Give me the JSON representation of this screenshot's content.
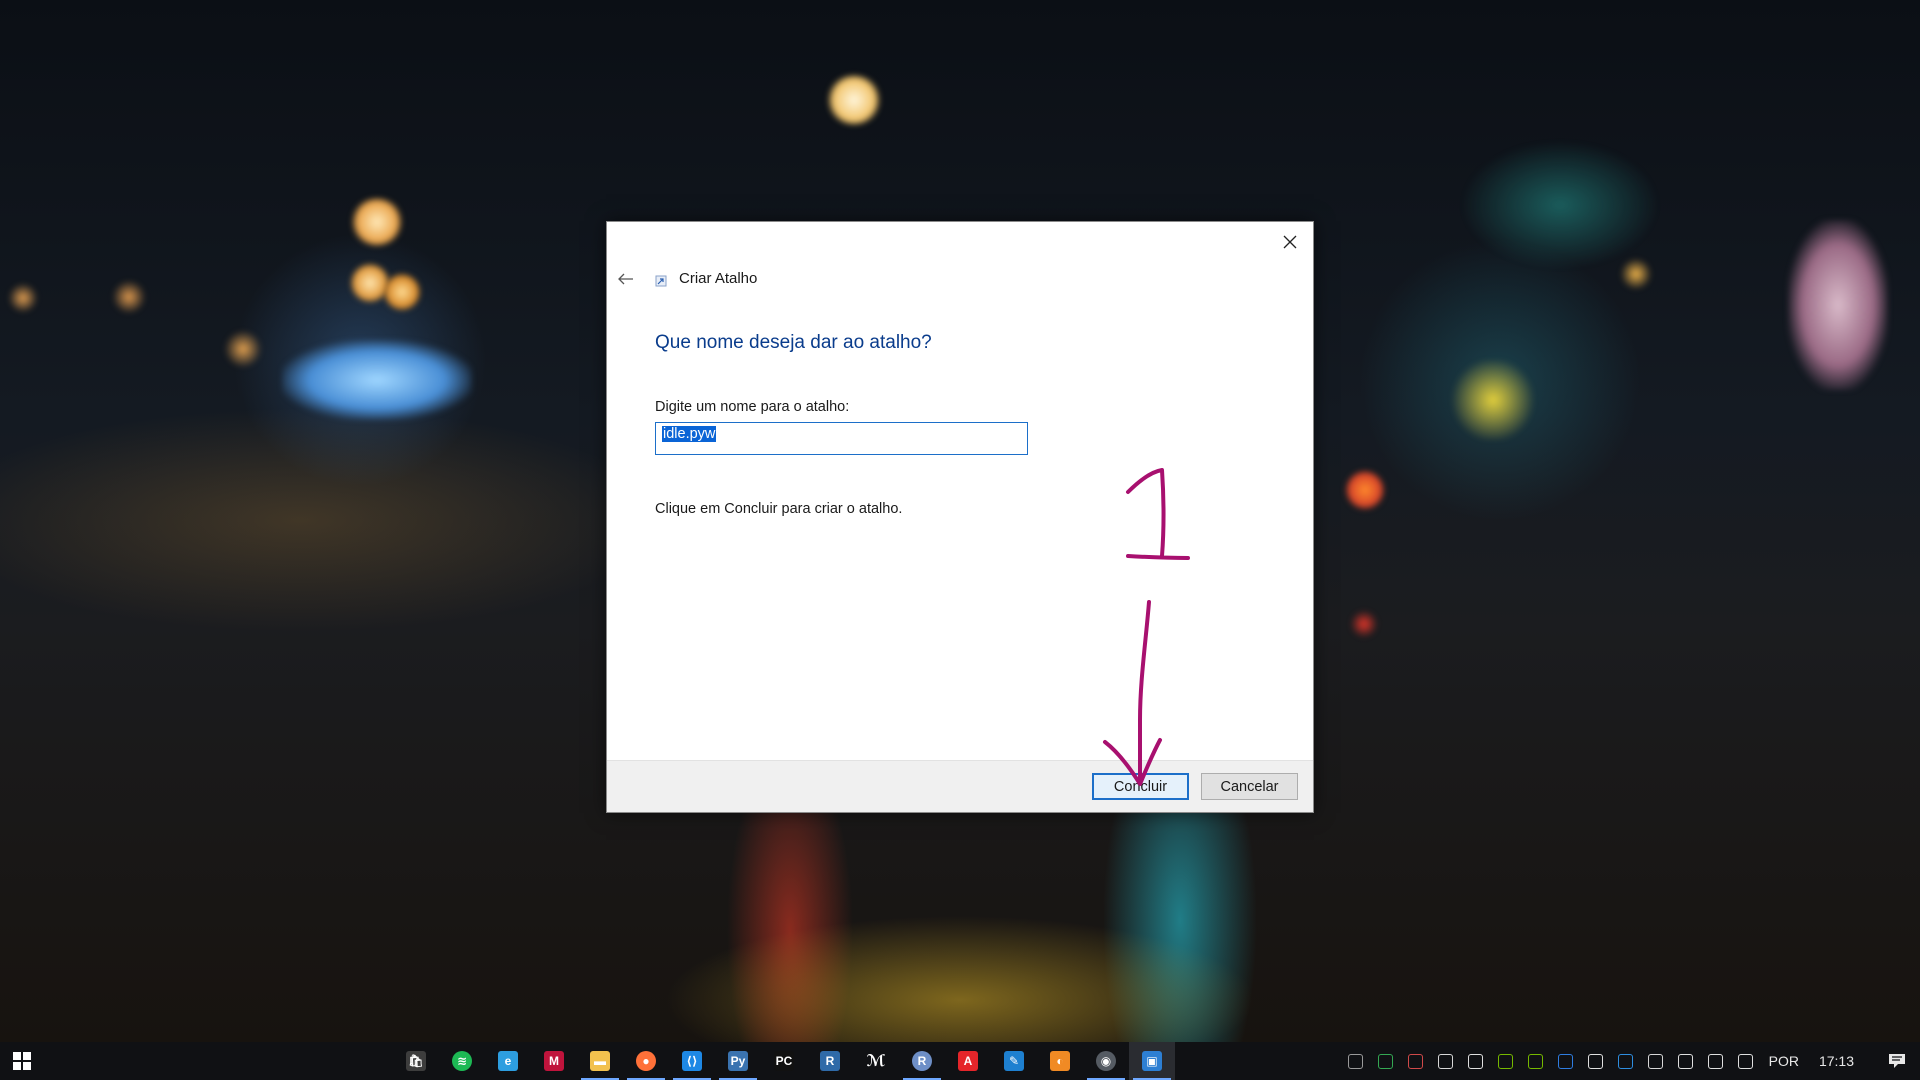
{
  "dialog": {
    "title": "Criar Atalho",
    "main_instruction": "Que nome deseja dar ao atalho?",
    "field_label": "Digite um nome para o atalho:",
    "field_value": "idle.pyw",
    "hint": "Clique em Concluir para criar o atalho.",
    "finish_label": "Concluir",
    "cancel_label": "Cancelar",
    "accent_color": "#1c6fc9",
    "instruction_color": "#0a3c8c"
  },
  "annotation": {
    "step_number": "1",
    "color": "#a8106f"
  },
  "taskbar": {
    "apps": [
      {
        "name": "store-icon",
        "color": "#3d3d3d",
        "glyph": "🛍"
      },
      {
        "name": "spotify-icon",
        "color": "#1db954",
        "glyph": "≋"
      },
      {
        "name": "edge-icon",
        "color": "#2d9ee0",
        "glyph": "e"
      },
      {
        "name": "mendeley-icon",
        "color": "#c0143c",
        "glyph": "M"
      },
      {
        "name": "file-explorer-icon",
        "color": "#f2c14e",
        "glyph": "▬"
      },
      {
        "name": "firefox-icon",
        "color": "#ff7139",
        "glyph": "●"
      },
      {
        "name": "vscode-icon",
        "color": "#1e88e5",
        "glyph": "⟨⟩"
      },
      {
        "name": "python-icon",
        "color": "#3a73b0",
        "glyph": "Py"
      },
      {
        "name": "pycharm-icon",
        "color": "#111111",
        "glyph": "PC"
      },
      {
        "name": "rstudio-icon",
        "color": "#2f6aa8",
        "glyph": "R"
      },
      {
        "name": "visual-studio-icon",
        "color": "#ffffff",
        "glyph": "ℳ"
      },
      {
        "name": "r-icon",
        "color": "#6e8fc7",
        "glyph": "R"
      },
      {
        "name": "acrobat-icon",
        "color": "#e5252a",
        "glyph": "A"
      },
      {
        "name": "notepad-icon",
        "color": "#1e80d0",
        "glyph": "✎"
      },
      {
        "name": "blender-icon",
        "color": "#f08a24",
        "glyph": "◐"
      },
      {
        "name": "obs-icon",
        "color": "#555b63",
        "glyph": "◉"
      },
      {
        "name": "photos-icon",
        "color": "#2d7fd3",
        "glyph": "▣"
      }
    ],
    "tray": [
      {
        "name": "obs-tray-icon",
        "color": "#9a9a9a"
      },
      {
        "name": "google-drive-icon",
        "color": "#34a853"
      },
      {
        "name": "antivirus-icon",
        "color": "#d04a4a"
      },
      {
        "name": "chat-icon",
        "color": "#d8d8d8"
      },
      {
        "name": "microphone-icon",
        "color": "#e0e0e0"
      },
      {
        "name": "nvidia-tray-icon",
        "color": "#76b900"
      },
      {
        "name": "nvidia-icon",
        "color": "#76b900"
      },
      {
        "name": "bluetooth-icon",
        "color": "#2f7de1"
      },
      {
        "name": "usb-icon",
        "color": "#e0e0e0"
      },
      {
        "name": "onedrive-icon",
        "color": "#2f8ee0"
      },
      {
        "name": "onedrive-sync-icon",
        "color": "#d8d8d8"
      },
      {
        "name": "battery-icon",
        "color": "#e0e0e0"
      },
      {
        "name": "network-icon",
        "color": "#e0e0e0"
      },
      {
        "name": "volume-icon",
        "color": "#e0e0e0"
      }
    ],
    "language": "POR",
    "time": "17:13"
  }
}
